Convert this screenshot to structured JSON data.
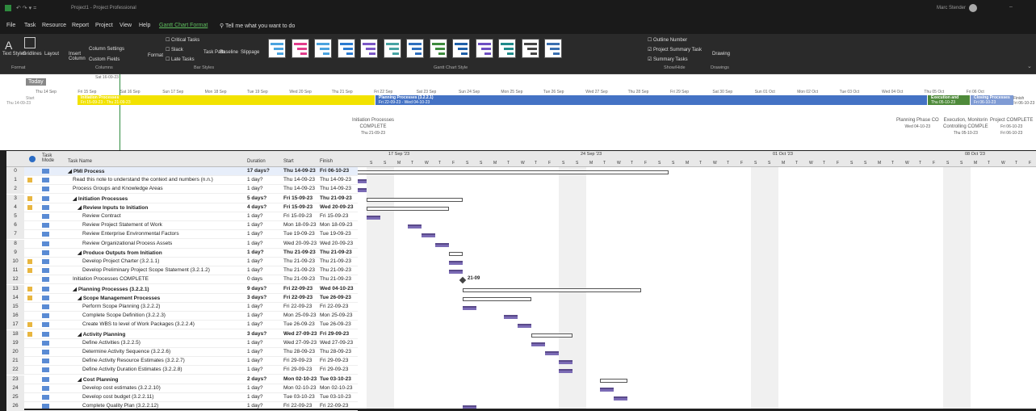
{
  "titlebar": {
    "title": "Project1 - Project Professional",
    "user": "Marc Stender"
  },
  "menu": [
    "File",
    "Task",
    "Resource",
    "Report",
    "Project",
    "View",
    "Help",
    "Gantt Chart Format"
  ],
  "search": "Tell me what you want to do",
  "ribbon": {
    "format_group": [
      "Text Styles",
      "Gridlines",
      "Layout"
    ],
    "columns_group": [
      "Insert Column",
      "Column Settings",
      "Custom Fields"
    ],
    "bar_styles": [
      "Critical Tasks",
      "Slack",
      "Late Tasks",
      "Format",
      "Task Path",
      "Baseline",
      "Slippage"
    ],
    "showhide": [
      "Outline Number",
      "Project Summary Task",
      "Summary Tasks"
    ],
    "drawing": "Drawing",
    "groups": [
      "Format",
      "Columns",
      "Bar Styles",
      "Gantt Chart Style",
      "Show/Hide",
      "Drawings"
    ],
    "swatch_colors": [
      "#4aa3df",
      "#e23c8c",
      "#4aa3df",
      "#2b7bd1",
      "#7a56c6",
      "#46a3a3",
      "#2e6fbe",
      "#3d8a3d",
      "#1e5fa8",
      "#6d4fc2",
      "#1f8a8a",
      "#444444",
      "#3a6fb0"
    ]
  },
  "timeline": {
    "today": "Today",
    "top_date": "Sat 16-09-23",
    "start_label": "Start",
    "start_date": "Thu 14-09-23",
    "finish_label": "Finish",
    "finish_date": "Fri 06-10-23",
    "dates": [
      "Thu 14 Sep",
      "Fri 15 Sep",
      "Sat 16 Sep",
      "Sun 17 Sep",
      "Mon 18 Sep",
      "Tue 19 Sep",
      "Wed 20 Sep",
      "Thu 21 Sep",
      "Fri 22 Sep",
      "Sat 23 Sep",
      "Sun 24 Sep",
      "Mon 25 Sep",
      "Tue 26 Sep",
      "Wed 27 Sep",
      "Thu 28 Sep",
      "Fri 29 Sep",
      "Sat 30 Sep",
      "Sun 01 Oct",
      "Mon 02 Oct",
      "Tue 03 Oct",
      "Wed 04 Oct",
      "Thu 05 Oct",
      "Fri 06 Oct"
    ],
    "bars": [
      {
        "name": "Initiation Processes",
        "dates": "Fri 15-09-23 - Thu 21-09-23",
        "color": "#f2e200"
      },
      {
        "name": "Planning Processes (3.2.2.1)",
        "dates": "Fri 22-09-23 - Wed 04-10-23",
        "color": "#4472c4"
      },
      {
        "name": "Execution and",
        "dates": "Thu 05-10-23",
        "color": "#4e8a3a"
      },
      {
        "name": "Closing Processes",
        "dates": "Fri 06-10-23",
        "color": "#7f9bd4"
      }
    ],
    "milestones": [
      {
        "l1": "Initiation Processes",
        "l2": "COMPLETE",
        "l3": "Thu 21-09-23"
      },
      {
        "l1": "Planning Phase CO",
        "l2": "Wed 04-10-23",
        "l3": ""
      },
      {
        "l1": "Execution, Monitorin",
        "l2": "Controlling COMPLE",
        "l3": "Thu 05-10-23"
      },
      {
        "l1": "Project COMPLETE",
        "l2": "Fri 06-10-23",
        "l3": "Fri 06-10-23"
      }
    ]
  },
  "grid": {
    "headers": {
      "mode": "Task Mode",
      "name": "Task Name",
      "duration": "Duration",
      "start": "Start",
      "finish": "Finish"
    },
    "rows": [
      {
        "id": "0",
        "name": "PMI Process",
        "dur": "17 days?",
        "start": "Thu 14-09-23",
        "finish": "Fri 06-10-23",
        "bold": true,
        "lvl": 0,
        "note": false
      },
      {
        "id": "1",
        "name": "Read this note to understand the context and numbers (n.n.)",
        "dur": "1 day?",
        "start": "Thu 14-09-23",
        "finish": "Thu 14-09-23",
        "bold": false,
        "lvl": 1,
        "note": true
      },
      {
        "id": "2",
        "name": "Process Groups and Knowledge Areas",
        "dur": "1 day?",
        "start": "Thu 14-09-23",
        "finish": "Thu 14-09-23",
        "bold": false,
        "lvl": 1,
        "note": false
      },
      {
        "id": "3",
        "name": "Initiation Processes",
        "dur": "5 days?",
        "start": "Fri 15-09-23",
        "finish": "Thu 21-09-23",
        "bold": true,
        "lvl": 1,
        "note": true
      },
      {
        "id": "4",
        "name": "Review Inputs to Initiation",
        "dur": "4 days?",
        "start": "Fri 15-09-23",
        "finish": "Wed 20-09-23",
        "bold": true,
        "lvl": 2,
        "note": true
      },
      {
        "id": "5",
        "name": "Review Contract",
        "dur": "1 day?",
        "start": "Fri 15-09-23",
        "finish": "Fri 15-09-23",
        "bold": false,
        "lvl": 3,
        "note": false
      },
      {
        "id": "6",
        "name": "Review Project Statement of Work",
        "dur": "1 day?",
        "start": "Mon 18-09-23",
        "finish": "Mon 18-09-23",
        "bold": false,
        "lvl": 3,
        "note": false
      },
      {
        "id": "7",
        "name": "Review Enterprise Environmental Factors",
        "dur": "1 day?",
        "start": "Tue 19-09-23",
        "finish": "Tue 19-09-23",
        "bold": false,
        "lvl": 3,
        "note": false
      },
      {
        "id": "8",
        "name": "Review Organizational Process Assets",
        "dur": "1 day?",
        "start": "Wed 20-09-23",
        "finish": "Wed 20-09-23",
        "bold": false,
        "lvl": 3,
        "note": false
      },
      {
        "id": "9",
        "name": "Produce Outputs from Initiation",
        "dur": "1 day?",
        "start": "Thu 21-09-23",
        "finish": "Thu 21-09-23",
        "bold": true,
        "lvl": 2,
        "note": false
      },
      {
        "id": "10",
        "name": "Develop Project Charter (3.2.1.1)",
        "dur": "1 day?",
        "start": "Thu 21-09-23",
        "finish": "Thu 21-09-23",
        "bold": false,
        "lvl": 3,
        "note": true
      },
      {
        "id": "11",
        "name": "Develop Preliminary Project Scope Statement (3.2.1.2)",
        "dur": "1 day?",
        "start": "Thu 21-09-23",
        "finish": "Thu 21-09-23",
        "bold": false,
        "lvl": 3,
        "note": true
      },
      {
        "id": "12",
        "name": "Initiation Processes COMPLETE",
        "dur": "0 days",
        "start": "Thu 21-09-23",
        "finish": "Thu 21-09-23",
        "bold": false,
        "lvl": 1,
        "note": false
      },
      {
        "id": "13",
        "name": "Planning Processes (3.2.2.1)",
        "dur": "9 days?",
        "start": "Fri 22-09-23",
        "finish": "Wed 04-10-23",
        "bold": true,
        "lvl": 1,
        "note": true
      },
      {
        "id": "14",
        "name": "Scope Management Processes",
        "dur": "3 days?",
        "start": "Fri 22-09-23",
        "finish": "Tue 26-09-23",
        "bold": true,
        "lvl": 2,
        "note": true
      },
      {
        "id": "15",
        "name": "Perform Scope Planning (3.2.2.2)",
        "dur": "1 day?",
        "start": "Fri 22-09-23",
        "finish": "Fri 22-09-23",
        "bold": false,
        "lvl": 3,
        "note": false
      },
      {
        "id": "16",
        "name": "Complete Scope Definition (3.2.2.3)",
        "dur": "1 day?",
        "start": "Mon 25-09-23",
        "finish": "Mon 25-09-23",
        "bold": false,
        "lvl": 3,
        "note": false
      },
      {
        "id": "17",
        "name": "Create WBS to level of Work Packages (3.2.2.4)",
        "dur": "1 day?",
        "start": "Tue 26-09-23",
        "finish": "Tue 26-09-23",
        "bold": false,
        "lvl": 3,
        "note": true
      },
      {
        "id": "18",
        "name": "Activity Planning",
        "dur": "3 days?",
        "start": "Wed 27-09-23",
        "finish": "Fri 29-09-23",
        "bold": true,
        "lvl": 2,
        "note": true
      },
      {
        "id": "19",
        "name": "Define Activities (3.2.2.5)",
        "dur": "1 day?",
        "start": "Wed 27-09-23",
        "finish": "Wed 27-09-23",
        "bold": false,
        "lvl": 3,
        "note": false
      },
      {
        "id": "20",
        "name": "Determine Activity Sequence (3.2.2.6)",
        "dur": "1 day?",
        "start": "Thu 28-09-23",
        "finish": "Thu 28-09-23",
        "bold": false,
        "lvl": 3,
        "note": false
      },
      {
        "id": "21",
        "name": "Define Activity Resource Estimates (3.2.2.7)",
        "dur": "1 day?",
        "start": "Fri 29-09-23",
        "finish": "Fri 29-09-23",
        "bold": false,
        "lvl": 3,
        "note": false
      },
      {
        "id": "22",
        "name": "Define Activity Duration Estimates (3.2.2.8)",
        "dur": "1 day?",
        "start": "Fri 29-09-23",
        "finish": "Fri 29-09-23",
        "bold": false,
        "lvl": 3,
        "note": false
      },
      {
        "id": "23",
        "name": "Cost Planning",
        "dur": "2 days?",
        "start": "Mon 02-10-23",
        "finish": "Tue 03-10-23",
        "bold": true,
        "lvl": 2,
        "note": false
      },
      {
        "id": "24",
        "name": "Develop cost estimates (3.2.2.10)",
        "dur": "1 day?",
        "start": "Mon 02-10-23",
        "finish": "Mon 02-10-23",
        "bold": false,
        "lvl": 3,
        "note": false
      },
      {
        "id": "25",
        "name": "Develop cost budget (3.2.2.11)",
        "dur": "1 day?",
        "start": "Tue 03-10-23",
        "finish": "Tue 03-10-23",
        "bold": false,
        "lvl": 3,
        "note": false
      },
      {
        "id": "26",
        "name": "Complete Quality Plan (3.2.2.12)",
        "dur": "1 day?",
        "start": "Fri 22-09-23",
        "finish": "Fri 22-09-23",
        "bold": false,
        "lvl": 3,
        "note": false
      }
    ]
  },
  "chart": {
    "weeks": [
      "17 Sep '23",
      "24 Sep '23",
      "01 Oct '23",
      "08 Oct '23"
    ],
    "days": [
      "S",
      "S",
      "M",
      "T",
      "W",
      "T",
      "F"
    ],
    "milestone_label": "21-09"
  }
}
